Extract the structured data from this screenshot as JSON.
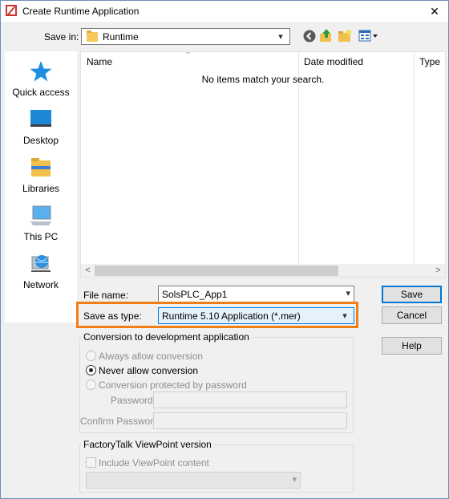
{
  "window": {
    "title": "Create Runtime Application",
    "close_glyph": "✕"
  },
  "save_in": {
    "label": "Save in:",
    "value": "Runtime"
  },
  "toolbar": {
    "icons": [
      "back-icon",
      "up-folder-icon",
      "new-folder-icon",
      "view-menu-icon"
    ]
  },
  "sidebar": {
    "items": [
      {
        "label": "Quick access",
        "icon": "star-icon"
      },
      {
        "label": "Desktop",
        "icon": "desktop-icon"
      },
      {
        "label": "Libraries",
        "icon": "libraries-icon"
      },
      {
        "label": "This PC",
        "icon": "computer-icon"
      },
      {
        "label": "Network",
        "icon": "network-icon"
      }
    ]
  },
  "filelist": {
    "columns": [
      "Name",
      "Date modified",
      "Type"
    ],
    "empty_message": "No items match your search."
  },
  "file_name": {
    "label": "File name:",
    "value": "SolsPLC_App1"
  },
  "save_as_type": {
    "label": "Save as type:",
    "value": "Runtime 5.10 Application (*.mer)"
  },
  "buttons": {
    "save": "Save",
    "cancel": "Cancel",
    "help": "Help"
  },
  "conversion": {
    "title": "Conversion to development application",
    "options": [
      "Always allow conversion",
      "Never allow conversion",
      "Conversion protected by password"
    ],
    "selected": "Never allow conversion",
    "password_label": "Password:",
    "confirm_label": "Confirm Password:"
  },
  "viewpoint": {
    "title": "FactoryTalk ViewPoint version",
    "include_label": "Include ViewPoint content"
  },
  "colors": {
    "highlight": "#f07f1a",
    "accent": "#0078d7"
  }
}
